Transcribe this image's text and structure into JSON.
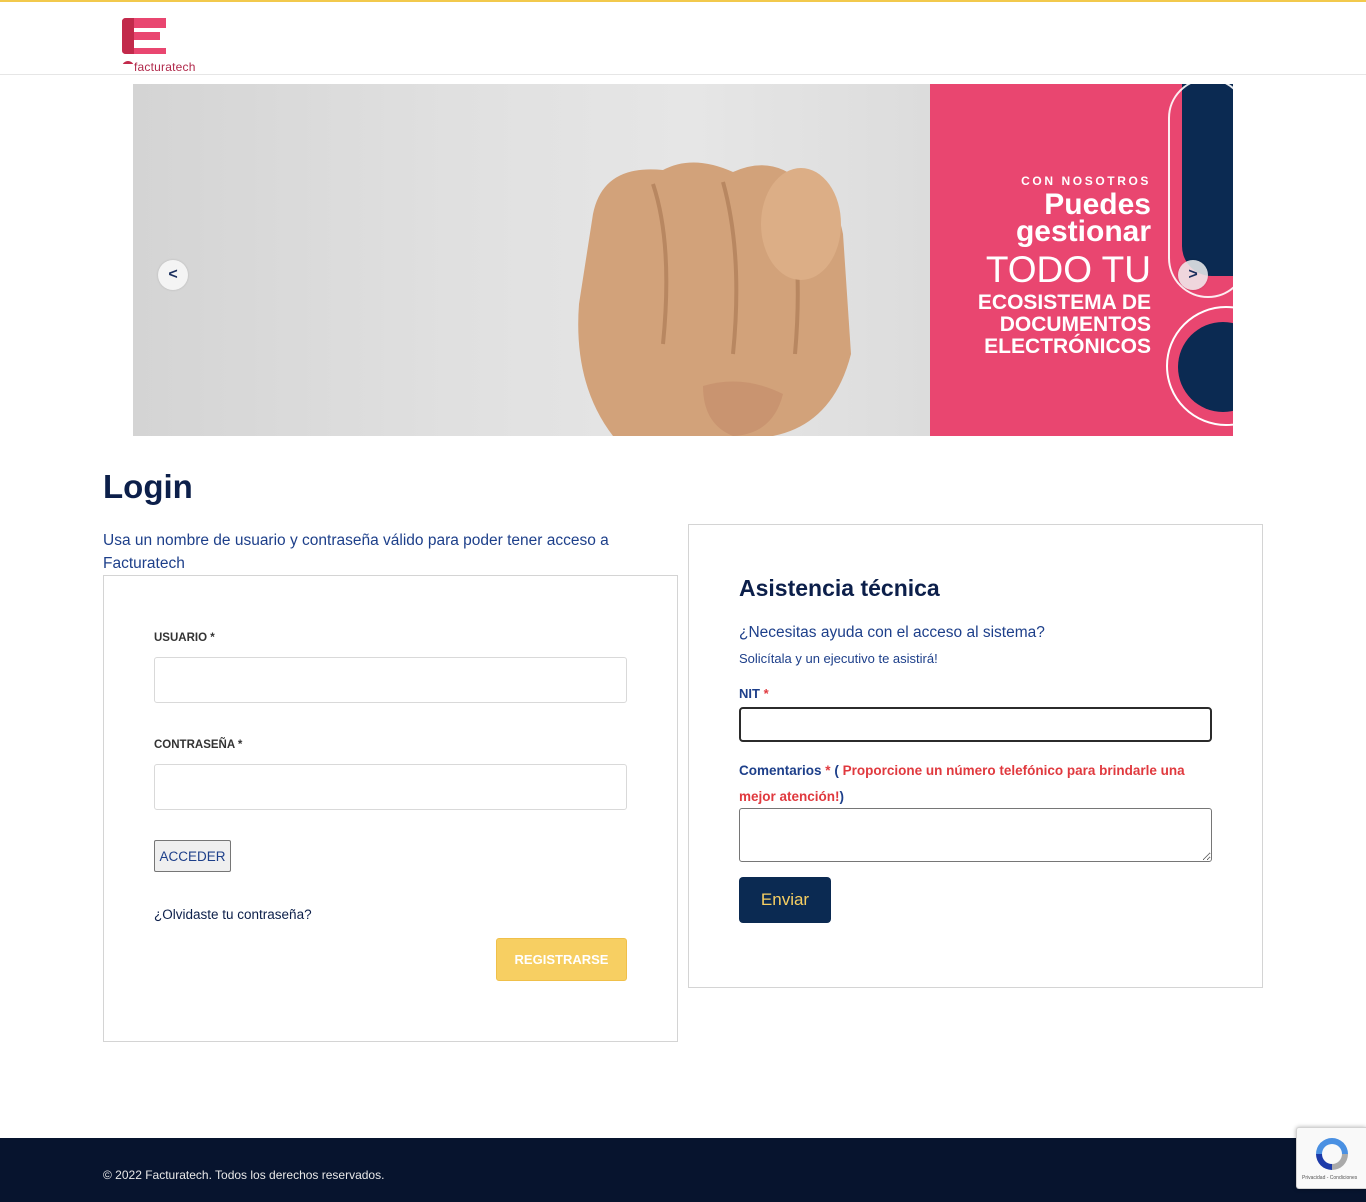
{
  "header": {
    "logo_text": "facturatech"
  },
  "banner": {
    "prev_label": "<",
    "next_label": ">",
    "line1": "CON NOSOTROS",
    "line2": "Puedes",
    "line3": "gestionar",
    "line4": "TODO TU",
    "line5": "ECOSISTEMA DE",
    "line6": "DOCUMENTOS",
    "line7": "ELECTRÓNICOS"
  },
  "login": {
    "title": "Login",
    "intro": "Usa un nombre de usuario y contraseña válido para poder tener acceso a Facturatech",
    "username_label": "USUARIO *",
    "password_label": "CONTRASEÑA *",
    "submit_label": "ACCEDER",
    "forgot_label": "¿Olvidaste tu contraseña?",
    "register_label": "REGISTRARSE"
  },
  "support": {
    "title": "Asistencia técnica",
    "question": "¿Necesitas ayuda con el acceso al sistema?",
    "subtitle": "Solicítala y un ejecutivo te asistirá!",
    "nit_label": "NIT",
    "required_mark": "*",
    "comments_label": "Comentarios",
    "comments_open": "(",
    "comments_note": "Proporcione un número telefónico para brindarle una mejor atención!",
    "comments_close": ")",
    "submit_label": "Enviar"
  },
  "footer": {
    "copyright": "© 2022 Facturatech. Todos los derechos reservados."
  },
  "recaptcha": {
    "links": "Privacidad - Condiciones"
  },
  "colors": {
    "brand_pink": "#e94670",
    "navy": "#0b2a52",
    "yellow": "#f7cf62",
    "footer_bg": "#07142e"
  }
}
